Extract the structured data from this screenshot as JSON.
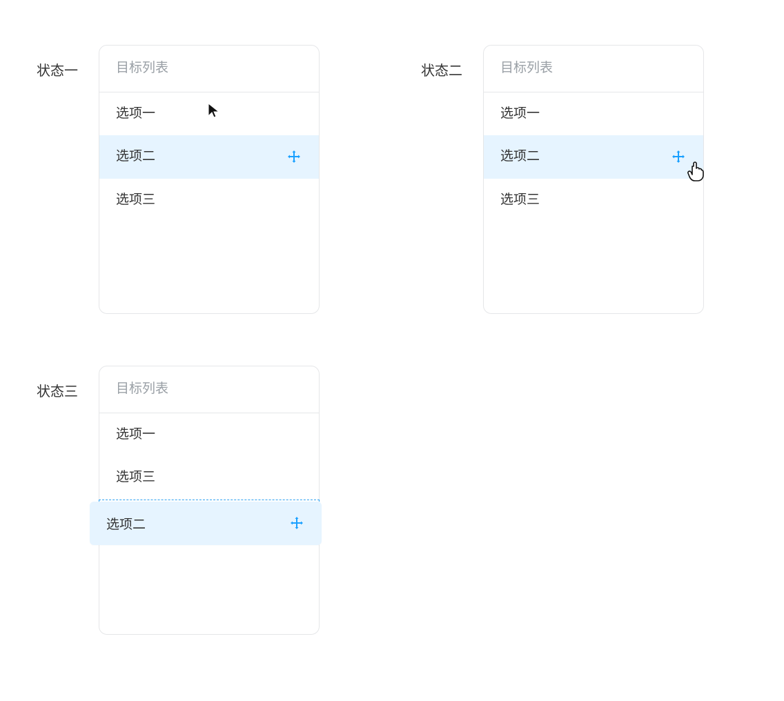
{
  "states": {
    "one": {
      "label": "状态一",
      "panelTitle": "目标列表",
      "items": [
        "选项一",
        "选项二",
        "选项三"
      ],
      "highlightedIndex": 1
    },
    "two": {
      "label": "状态二",
      "panelTitle": "目标列表",
      "items": [
        "选项一",
        "选项二",
        "选项三"
      ],
      "highlightedIndex": 1
    },
    "three": {
      "label": "状态三",
      "panelTitle": "目标列表",
      "items": [
        "选项一",
        "选项三"
      ],
      "floatingItem": "选项二"
    }
  },
  "colors": {
    "highlightBg": "#e6f4ff",
    "moveIcon": "#1aa0ff",
    "dashedBorder": "#2aa0f2",
    "mutedText": "#9aa0a6",
    "text": "#333333"
  }
}
